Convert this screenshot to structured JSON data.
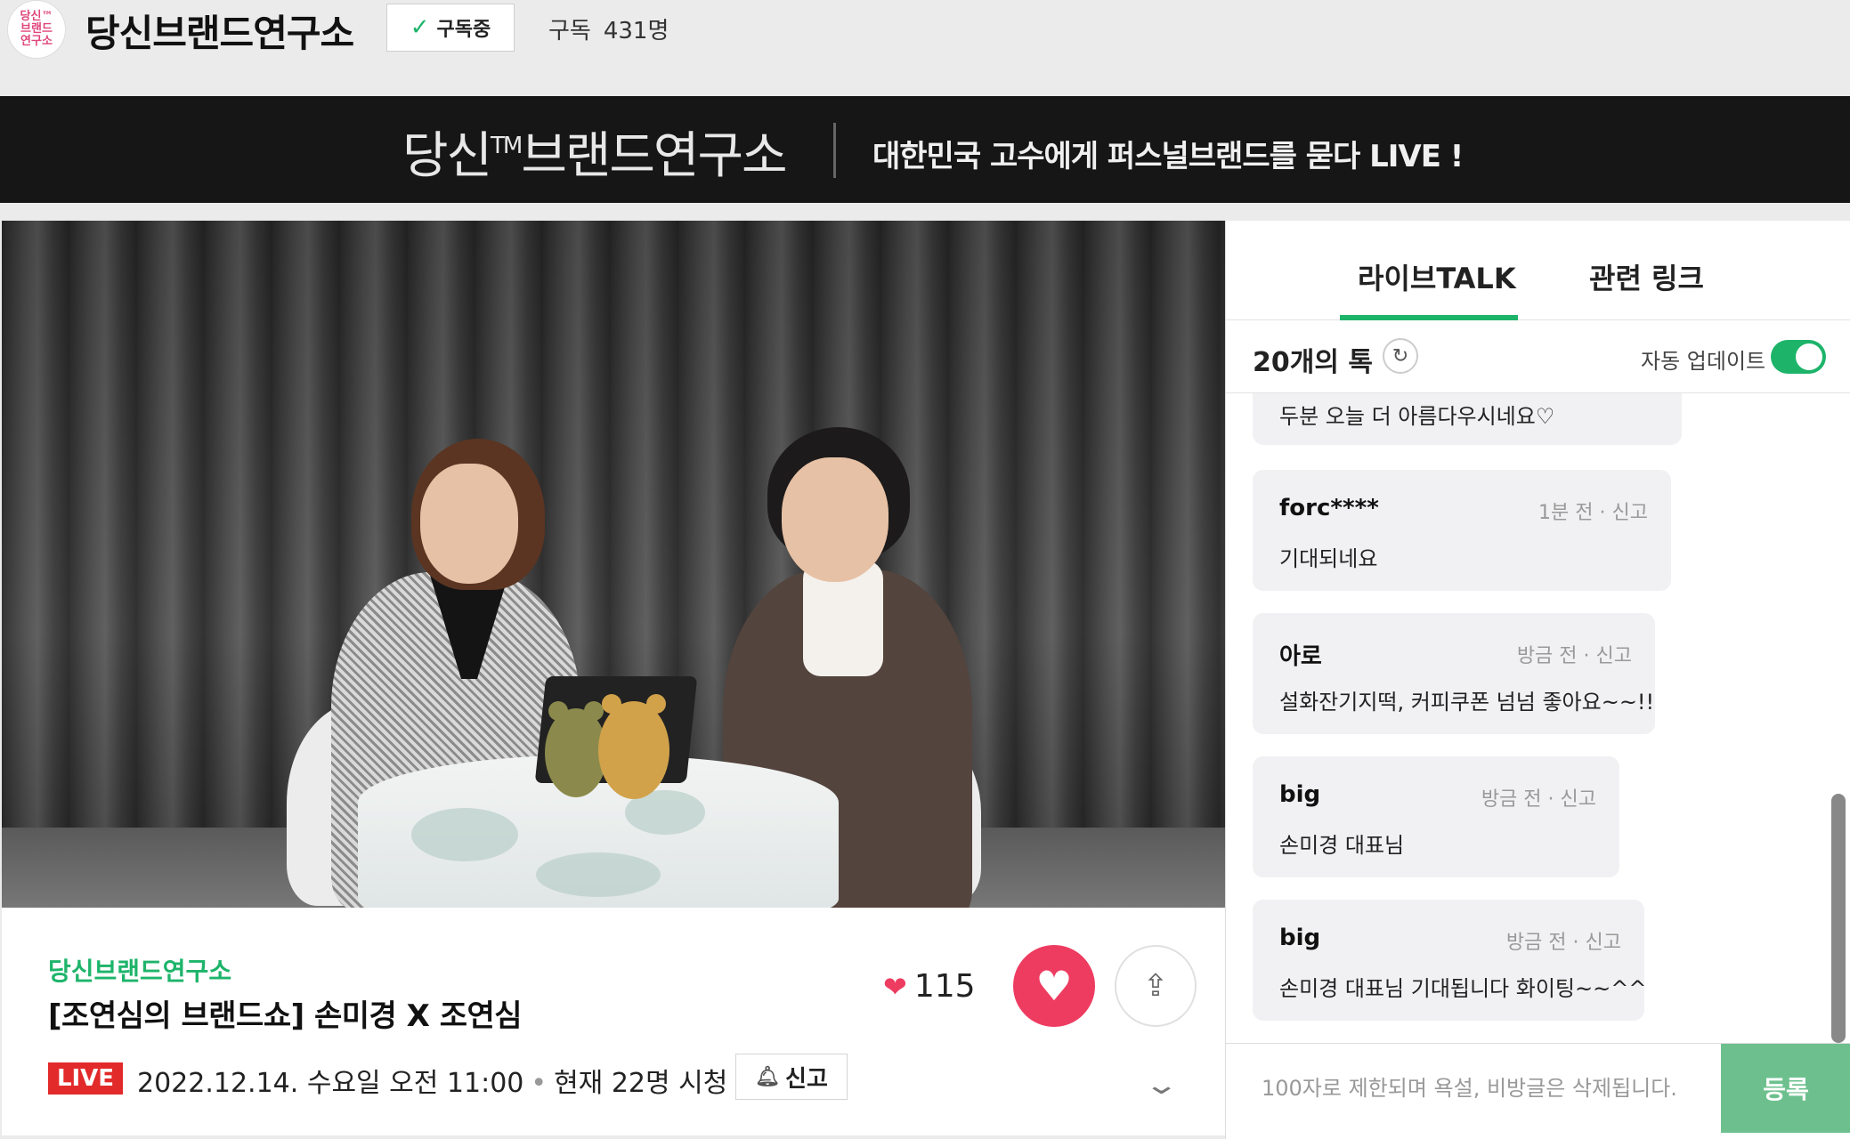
{
  "channel": {
    "logo_text": "당신™\n브랜드\n연구소",
    "name": "당신브랜드연구소",
    "subscribe_label": "구독중",
    "subscribers_label": "구독",
    "subscribers_count": "431명"
  },
  "banner": {
    "logo_text": "당신",
    "logo_tm": "TM",
    "logo_rest": "브랜드연구소",
    "tagline": "대한민국 고수에게 퍼스널브랜드를 묻다 LIVE !"
  },
  "stream": {
    "channel_name": "당신브랜드연구소",
    "title": "[조연심의 브랜드쇼] 손미경 X 조연심",
    "live_badge": "LIVE",
    "datetime": "2022.12.14. 수요일 오전 11:00",
    "viewers": "현재 22명 시청",
    "report_label": "신고",
    "likes": "115"
  },
  "panel": {
    "tabs": [
      {
        "label": "라이브TALK",
        "active": true
      },
      {
        "label": "관련 링크",
        "active": false
      }
    ],
    "talk_count": "20개의 톡",
    "auto_update_label": "자동 업데이트",
    "auto_update_on": true,
    "messages": [
      {
        "user": "",
        "time": "",
        "report": "",
        "text": "두분 오늘 더 아름다우시네요♡"
      },
      {
        "user": "forc****",
        "time": "1분 전",
        "report": "신고",
        "text": "기대되네요"
      },
      {
        "user": "아로",
        "time": "방금 전",
        "report": "신고",
        "text": "설화잔기지떡, 커피쿠폰 넘넘 좋아요~~!!"
      },
      {
        "user": "big",
        "time": "방금 전",
        "report": "신고",
        "text": "손미경 대표님"
      },
      {
        "user": "big",
        "time": "방금 전",
        "report": "신고",
        "text": "손미경 대표님 기대됩니다 화이팅~~^^"
      }
    ],
    "input_placeholder": "100자로 제한되며 욕설, 비방글은 삭제됩니다.",
    "send_label": "등록"
  },
  "colors": {
    "accent_green": "#1db46a",
    "like_red": "#ee3c61",
    "live_red": "#e22a2a",
    "banner_bg": "#161616"
  }
}
